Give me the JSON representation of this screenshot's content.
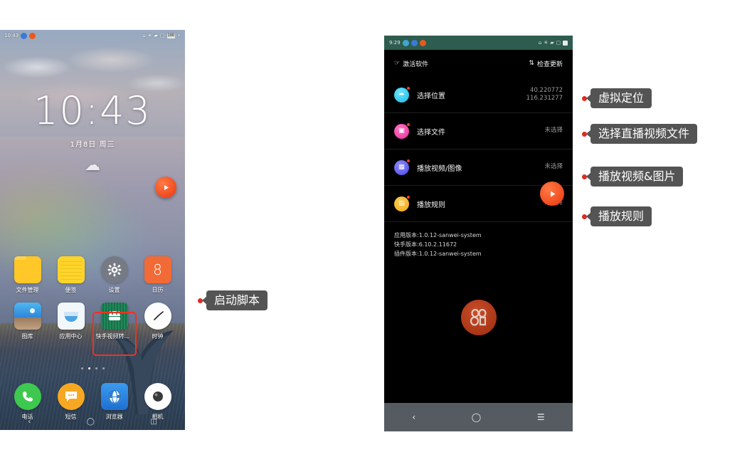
{
  "left_phone": {
    "status_bar": {
      "time": "10:43",
      "icons": [
        "home-icon",
        "bluetooth-icon",
        "wifi-icon",
        "sim-icon",
        "battery-icon",
        "charging-icon"
      ]
    },
    "lock": {
      "time": "10:43",
      "date": "1月8日  周三",
      "weather_icon": "cloud-icon"
    },
    "fab": {
      "icon": "play-icon"
    },
    "apps_row1": [
      {
        "label": "文件管理",
        "icon": "folder-icon"
      },
      {
        "label": "便签",
        "icon": "notes-icon"
      },
      {
        "label": "设置",
        "icon": "gear-icon"
      },
      {
        "label": "日历",
        "icon": "calendar-icon",
        "glyph": "8"
      }
    ],
    "apps_row2": [
      {
        "label": "图库",
        "icon": "gallery-icon"
      },
      {
        "label": "应用中心",
        "icon": "app-center-icon"
      },
      {
        "label": "快手视频转换…",
        "icon": "android-robot-icon",
        "highlighted": true
      },
      {
        "label": "时钟",
        "icon": "clock-icon"
      }
    ],
    "dock": [
      {
        "label": "电话",
        "icon": "phone-icon"
      },
      {
        "label": "短信",
        "icon": "message-icon"
      },
      {
        "label": "浏览器",
        "icon": "globe-icon"
      },
      {
        "label": "相机",
        "icon": "camera-icon"
      }
    ],
    "page_dots": {
      "count": 4,
      "active": 1
    },
    "navbar": [
      "back-icon",
      "home-icon",
      "recents-icon"
    ]
  },
  "right_phone": {
    "status_bar": {
      "time": "9:29",
      "icons": [
        "home-icon",
        "bluetooth-icon",
        "wifi-icon",
        "sim-icon",
        "battery-icon"
      ]
    },
    "header": {
      "activate_label": "激活软件",
      "activate_icon": "pointer-icon",
      "update_label": "检查更新",
      "update_icon": "refresh-icon"
    },
    "rows": [
      {
        "label": "选择位置",
        "value": "40.220772\n116.231277",
        "icon": "location-icon"
      },
      {
        "label": "选择文件",
        "value": "未选择",
        "icon": "file-icon"
      },
      {
        "label": "播放视频/图像",
        "value": "未选择",
        "icon": "video-icon"
      },
      {
        "label": "播放规则",
        "value": "未选择",
        "icon": "rules-icon"
      }
    ],
    "fab": {
      "icon": "play-icon"
    },
    "versions": [
      "应用版本:1.0.12-sanwei-system",
      "快手版本:6.10.2.11672",
      "插件版本:1.0.12-sanwei-system"
    ],
    "watermark": {
      "icon": "kuaishou-logo-icon"
    },
    "navbar": [
      "back-icon",
      "home-icon",
      "recents-icon"
    ]
  },
  "annotations": [
    {
      "text": "启动脚本",
      "id": "launch-script"
    },
    {
      "text": "虚拟定位",
      "id": "virtual-location"
    },
    {
      "text": "选择直播视频文件",
      "id": "select-live-video-file"
    },
    {
      "text": "播放视频&图片",
      "id": "play-video-and-image"
    },
    {
      "text": "播放规则",
      "id": "play-rules"
    }
  ],
  "colors": {
    "annotation_bubble": "#545454",
    "annotation_dot": "#e02b20",
    "highlight_box": "#ee3322",
    "fab": "#f04a1e",
    "status_bar_right": "#2e5c4e"
  }
}
